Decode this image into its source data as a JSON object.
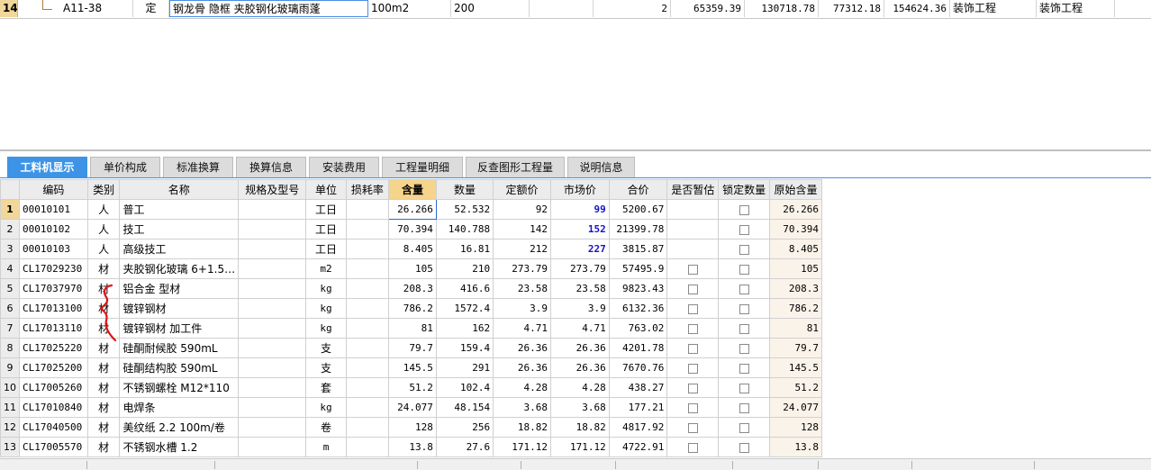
{
  "top_row": {
    "row_number": "14",
    "code": "A11-38",
    "type": "定",
    "name": "钢龙骨 隐框 夹胶钢化玻璃雨蓬",
    "unit": "100m2",
    "qty_expr": "200",
    "qty": "2",
    "unit_price": "65359.39",
    "total": "130718.78",
    "fee1": "77312.18",
    "fee2": "154624.36",
    "major1": "装饰工程",
    "major2": "装饰工程"
  },
  "tabs": [
    {
      "label": "工料机显示",
      "active": true
    },
    {
      "label": "单价构成"
    },
    {
      "label": "标准换算"
    },
    {
      "label": "换算信息"
    },
    {
      "label": "安装费用"
    },
    {
      "label": "工程量明细"
    },
    {
      "label": "反查图形工程量"
    },
    {
      "label": "说明信息"
    }
  ],
  "columns": [
    "编码",
    "类别",
    "名称",
    "规格及型号",
    "单位",
    "损耗率",
    "含量",
    "数量",
    "定额价",
    "市场价",
    "合价",
    "是否暂估",
    "锁定数量",
    "原始含量"
  ],
  "rows": [
    {
      "no": "1",
      "code": "00010101",
      "cat": "人",
      "name": "普工",
      "spec": "",
      "unit": "工日",
      "loss": "",
      "content": "26.266",
      "qty": "52.532",
      "quota": "92",
      "market": "99",
      "total": "5200.67",
      "est": false,
      "lock": true,
      "orig": "26.266"
    },
    {
      "no": "2",
      "code": "00010102",
      "cat": "人",
      "name": "技工",
      "spec": "",
      "unit": "工日",
      "loss": "",
      "content": "70.394",
      "qty": "140.788",
      "quota": "142",
      "market": "152",
      "total": "21399.78",
      "est": false,
      "lock": true,
      "orig": "70.394"
    },
    {
      "no": "3",
      "code": "00010103",
      "cat": "人",
      "name": "高级技工",
      "spec": "",
      "unit": "工日",
      "loss": "",
      "content": "8.405",
      "qty": "16.81",
      "quota": "212",
      "market": "227",
      "total": "3815.87",
      "est": false,
      "lock": true,
      "orig": "8.405"
    },
    {
      "no": "4",
      "code": "CL17029230",
      "cat": "材",
      "name": "夹胶钢化玻璃 6+1.5…",
      "spec": "",
      "unit": "m2",
      "loss": "",
      "content": "105",
      "qty": "210",
      "quota": "273.79",
      "market": "273.79",
      "total": "57495.9",
      "est": true,
      "lock": true,
      "orig": "105"
    },
    {
      "no": "5",
      "code": "CL17037970",
      "cat": "材",
      "name": "铝合金 型材",
      "spec": "",
      "unit": "kg",
      "loss": "",
      "content": "208.3",
      "qty": "416.6",
      "quota": "23.58",
      "market": "23.58",
      "total": "9823.43",
      "est": true,
      "lock": true,
      "orig": "208.3"
    },
    {
      "no": "6",
      "code": "CL17013100",
      "cat": "材",
      "name": "镀锌钢材",
      "spec": "",
      "unit": "kg",
      "loss": "",
      "content": "786.2",
      "qty": "1572.4",
      "quota": "3.9",
      "market": "3.9",
      "total": "6132.36",
      "est": true,
      "lock": true,
      "orig": "786.2"
    },
    {
      "no": "7",
      "code": "CL17013110",
      "cat": "材",
      "name": "镀锌钢材 加工件",
      "spec": "",
      "unit": "kg",
      "loss": "",
      "content": "81",
      "qty": "162",
      "quota": "4.71",
      "market": "4.71",
      "total": "763.02",
      "est": true,
      "lock": true,
      "orig": "81"
    },
    {
      "no": "8",
      "code": "CL17025220",
      "cat": "材",
      "name": "硅酮耐候胶 590mL",
      "spec": "",
      "unit": "支",
      "loss": "",
      "content": "79.7",
      "qty": "159.4",
      "quota": "26.36",
      "market": "26.36",
      "total": "4201.78",
      "est": true,
      "lock": true,
      "orig": "79.7"
    },
    {
      "no": "9",
      "code": "CL17025200",
      "cat": "材",
      "name": "硅酮结构胶 590mL",
      "spec": "",
      "unit": "支",
      "loss": "",
      "content": "145.5",
      "qty": "291",
      "quota": "26.36",
      "market": "26.36",
      "total": "7670.76",
      "est": true,
      "lock": true,
      "orig": "145.5"
    },
    {
      "no": "10",
      "code": "CL17005260",
      "cat": "材",
      "name": "不锈钢螺栓 M12*110",
      "spec": "",
      "unit": "套",
      "loss": "",
      "content": "51.2",
      "qty": "102.4",
      "quota": "4.28",
      "market": "4.28",
      "total": "438.27",
      "est": true,
      "lock": true,
      "orig": "51.2"
    },
    {
      "no": "11",
      "code": "CL17010840",
      "cat": "材",
      "name": "电焊条",
      "spec": "",
      "unit": "kg",
      "loss": "",
      "content": "24.077",
      "qty": "48.154",
      "quota": "3.68",
      "market": "3.68",
      "total": "177.21",
      "est": true,
      "lock": true,
      "orig": "24.077"
    },
    {
      "no": "12",
      "code": "CL17040500",
      "cat": "材",
      "name": "美纹纸 2.2 100m/卷",
      "spec": "",
      "unit": "卷",
      "loss": "",
      "content": "128",
      "qty": "256",
      "quota": "18.82",
      "market": "18.82",
      "total": "4817.92",
      "est": true,
      "lock": true,
      "orig": "128"
    },
    {
      "no": "13",
      "code": "CL17005570",
      "cat": "材",
      "name": "不锈钢水槽 1.2",
      "spec": "",
      "unit": "m",
      "loss": "",
      "content": "13.8",
      "qty": "27.6",
      "quota": "171.12",
      "market": "171.12",
      "total": "4722.91",
      "est": true,
      "lock": true,
      "orig": "13.8"
    }
  ],
  "icons": {
    "checkbox": "checkbox-icon",
    "tree": "tree-connector-icon",
    "annotation": "red-bracket-annotation"
  },
  "colors": {
    "active_tab": "#3d94e6",
    "header_highlight": "#f6d48c",
    "market_price": "#1414c8",
    "annotation": "#e01414"
  }
}
